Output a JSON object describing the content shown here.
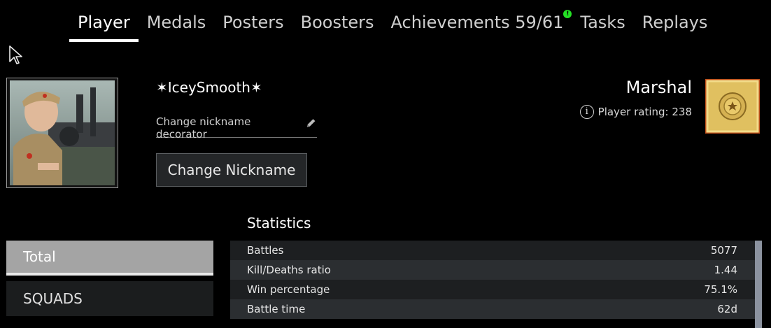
{
  "tabs": [
    {
      "label": "Player",
      "active": true
    },
    {
      "label": "Medals",
      "active": false
    },
    {
      "label": "Posters",
      "active": false
    },
    {
      "label": "Boosters",
      "active": false
    },
    {
      "label": "Achievements 59/61",
      "active": false,
      "badge": "!"
    },
    {
      "label": "Tasks",
      "active": false
    },
    {
      "label": "Replays",
      "active": false
    }
  ],
  "profile": {
    "nickname": "✶IceySmooth✶",
    "decorator_label": "Change nickname decorator",
    "change_nickname_label": "Change Nickname",
    "rank": "Marshal",
    "rating_label": "Player rating: 238"
  },
  "sidebar": {
    "items": [
      {
        "label": "Total",
        "active": true
      },
      {
        "label": "SQUADS",
        "active": false
      }
    ]
  },
  "statistics": {
    "title": "Statistics",
    "rows": [
      {
        "label": "Battles",
        "value": "5077"
      },
      {
        "label": "Kill/Deaths ratio",
        "value": "1.44"
      },
      {
        "label": "Win percentage",
        "value": "75.1%"
      },
      {
        "label": "Battle time",
        "value": "62d"
      }
    ]
  },
  "colors": {
    "background": "#000000",
    "badge_green": "#24e024",
    "rank_gold": "#e0c060",
    "rank_border": "#c0501a"
  }
}
